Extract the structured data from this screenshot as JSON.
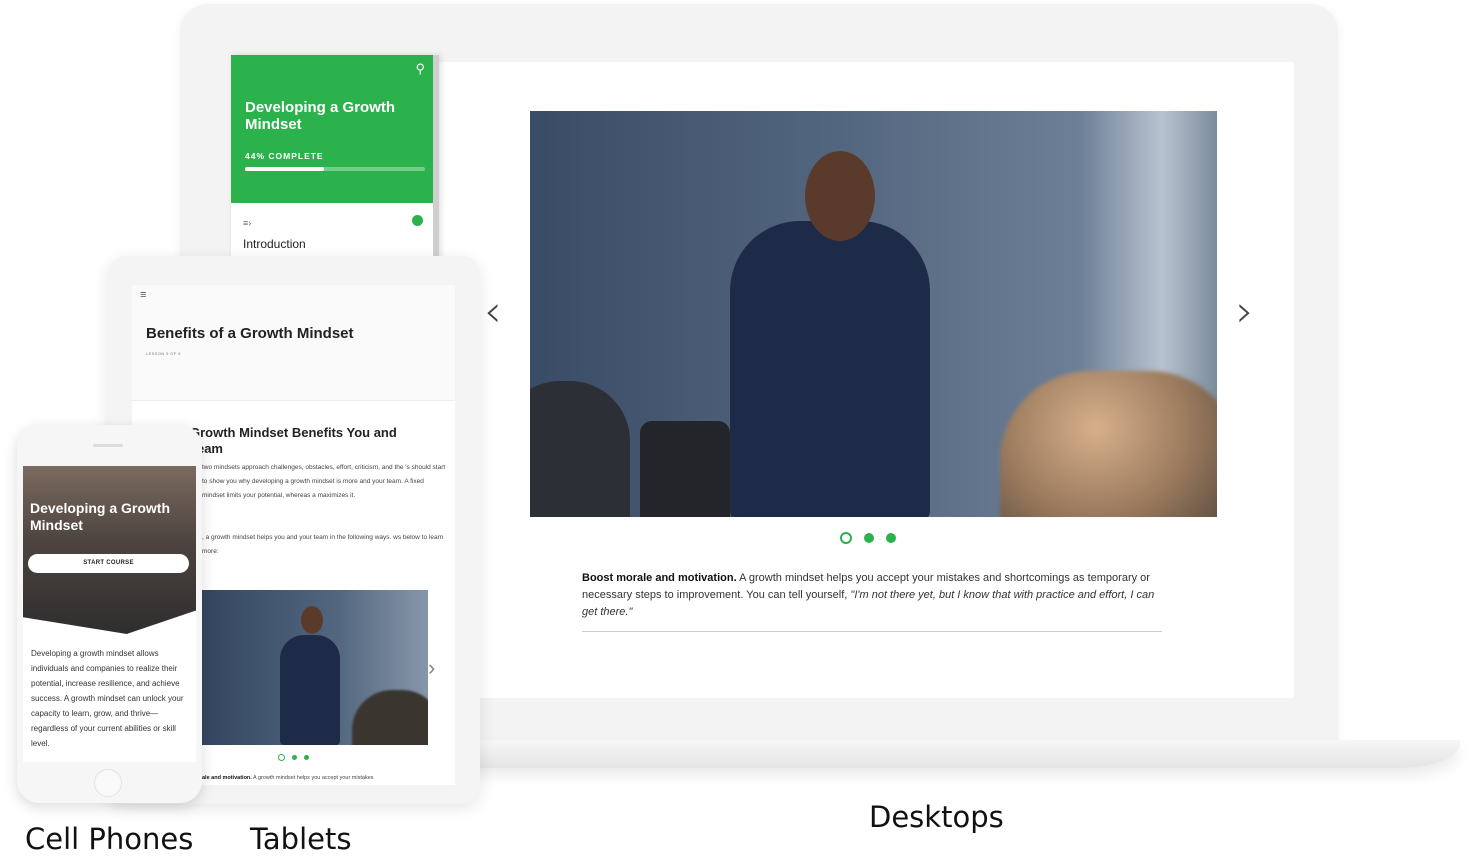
{
  "desktop": {
    "sidebar": {
      "course_title": "Developing a Growth Mindset",
      "progress_text": "44% COMPLETE",
      "progress_fraction": 0.44,
      "search_icon": "search-icon",
      "item_label": "Introduction"
    },
    "carousel": {
      "prev_arrow": "‹",
      "next_arrow": "›",
      "dot_count": 3,
      "active_dot": 0
    },
    "caption": {
      "bold": "Boost morale and motivation.",
      "text": " A growth mindset helps you accept your mistakes and shortcomings as temporary or necessary steps to improvement. You can tell yourself, ",
      "quote": "\"I'm not there yet, but I know that with practice and effort, I can get there.\""
    },
    "accent_color": "#2bb24c"
  },
  "tablet": {
    "menu_icon": "≡",
    "title": "Benefits of a Growth Mindset",
    "lesson": "LESSON 5 OF 9",
    "heading": "Growth Mindset Benefits You and Team",
    "para1": "two mindsets approach challenges, obstacles, effort, criticism, and the 's should start to show you why developing a growth mindset is more and your team. A fixed mindset limits your potential, whereas a maximizes it.",
    "para2": ", a growth mindset helps you and your team in the following ways. ws below to learn more:",
    "next_arrow": "›",
    "caption_bold": "ale and motivation.",
    "caption_text": " A growth mindset helps you accept your mistakes"
  },
  "phone": {
    "title": "Developing a Growth Mindset",
    "start_button": "START COURSE",
    "body": "Developing a growth mindset allows individuals and companies to realize their potential, increase resilience, and achieve success. A growth mindset can unlock your capacity to learn, grow, and thrive—regardless of your current abilities or skill level."
  },
  "labels": {
    "phones": "Cell Phones",
    "tablets": "Tablets",
    "desktops": "Desktops"
  }
}
